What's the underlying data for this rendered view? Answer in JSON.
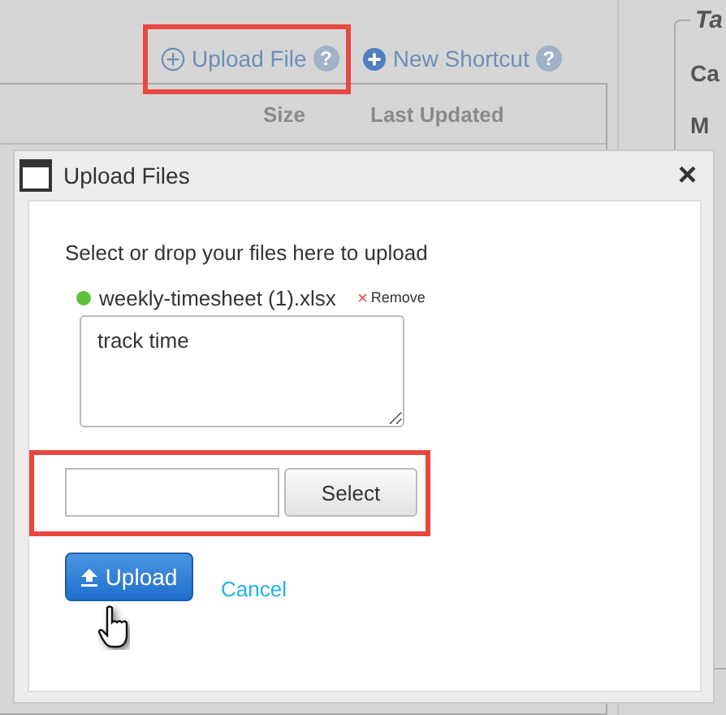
{
  "toolbar": {
    "links": [
      {
        "label": "Upload File",
        "kind": "outline",
        "help": "?"
      },
      {
        "label": "New Shortcut",
        "kind": "filled",
        "help": "?"
      }
    ]
  },
  "table": {
    "columns": [
      "Size",
      "Last Updated"
    ]
  },
  "side_panel": {
    "legend": "Ta",
    "labels": [
      "Ca",
      "M"
    ]
  },
  "dialog": {
    "title": "Upload Files",
    "close": "×",
    "instructions": "Select or drop your files here to upload",
    "files": [
      {
        "name": "weekly-timesheet (1).xlsx",
        "color": "#5cc23a",
        "remove_mark": "×",
        "remove": "Remove",
        "note": "track time"
      }
    ],
    "file_input": {
      "button": "Select"
    },
    "upload": "Upload",
    "cancel": "Cancel"
  }
}
